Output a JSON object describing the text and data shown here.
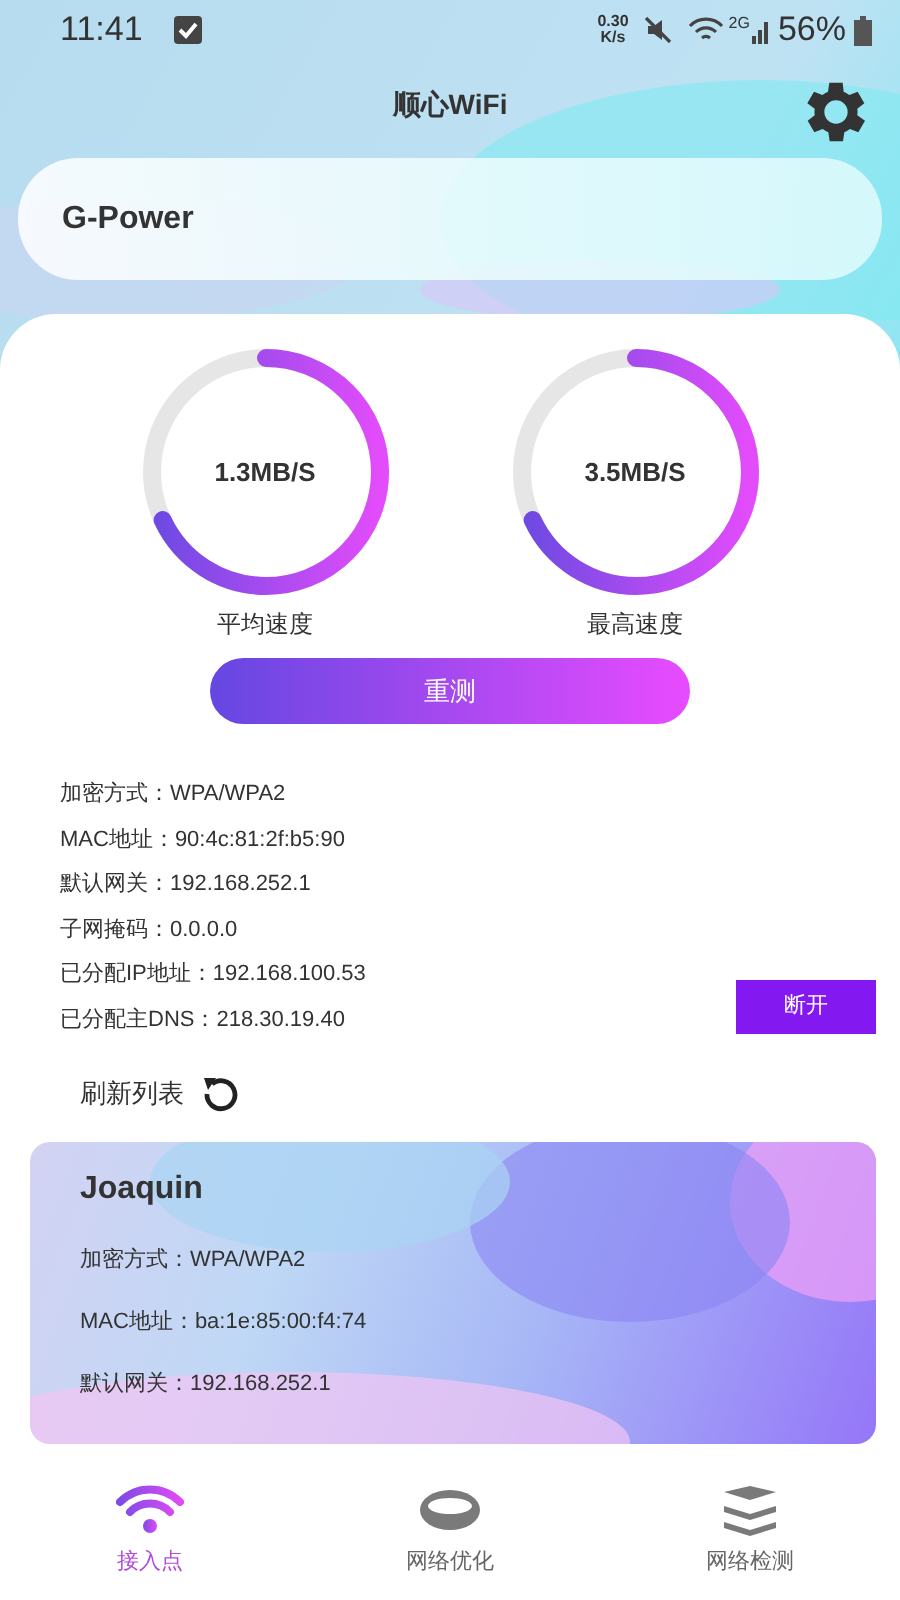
{
  "status_bar": {
    "time": "11:41",
    "net_speed_value": "0.30",
    "net_speed_unit": "K/s",
    "network": "2G",
    "battery": "56%"
  },
  "app_title": "顺心WiFi",
  "current_network": {
    "name": "G-Power"
  },
  "gauges": [
    {
      "value": "1.3MB/S",
      "label": "平均速度",
      "level": 0.68
    },
    {
      "value": "3.5MB/S",
      "label": "最高速度",
      "level": 0.68
    }
  ],
  "retest_button": "重测",
  "connection_info": [
    "加密方式：WPA/WPA2",
    "MAC地址：90:4c:81:2f:b5:90",
    "默认网关：192.168.252.1",
    "子网掩码：0.0.0.0",
    "已分配IP地址：192.168.100.53",
    "已分配主DNS：218.30.19.40"
  ],
  "disconnect_button": "断开",
  "refresh_label": "刷新列表",
  "networks": [
    {
      "name": "Joaquin",
      "details": [
        "加密方式：WPA/WPA2",
        "MAC地址：ba:1e:85:00:f4:74",
        "默认网关：192.168.252.1"
      ]
    }
  ],
  "bottom_nav": [
    {
      "label": "接入点",
      "selected": true,
      "kind": "wifi"
    },
    {
      "label": "网络优化",
      "selected": false,
      "kind": "ring"
    },
    {
      "label": "网络检测",
      "selected": false,
      "kind": "layers"
    }
  ]
}
